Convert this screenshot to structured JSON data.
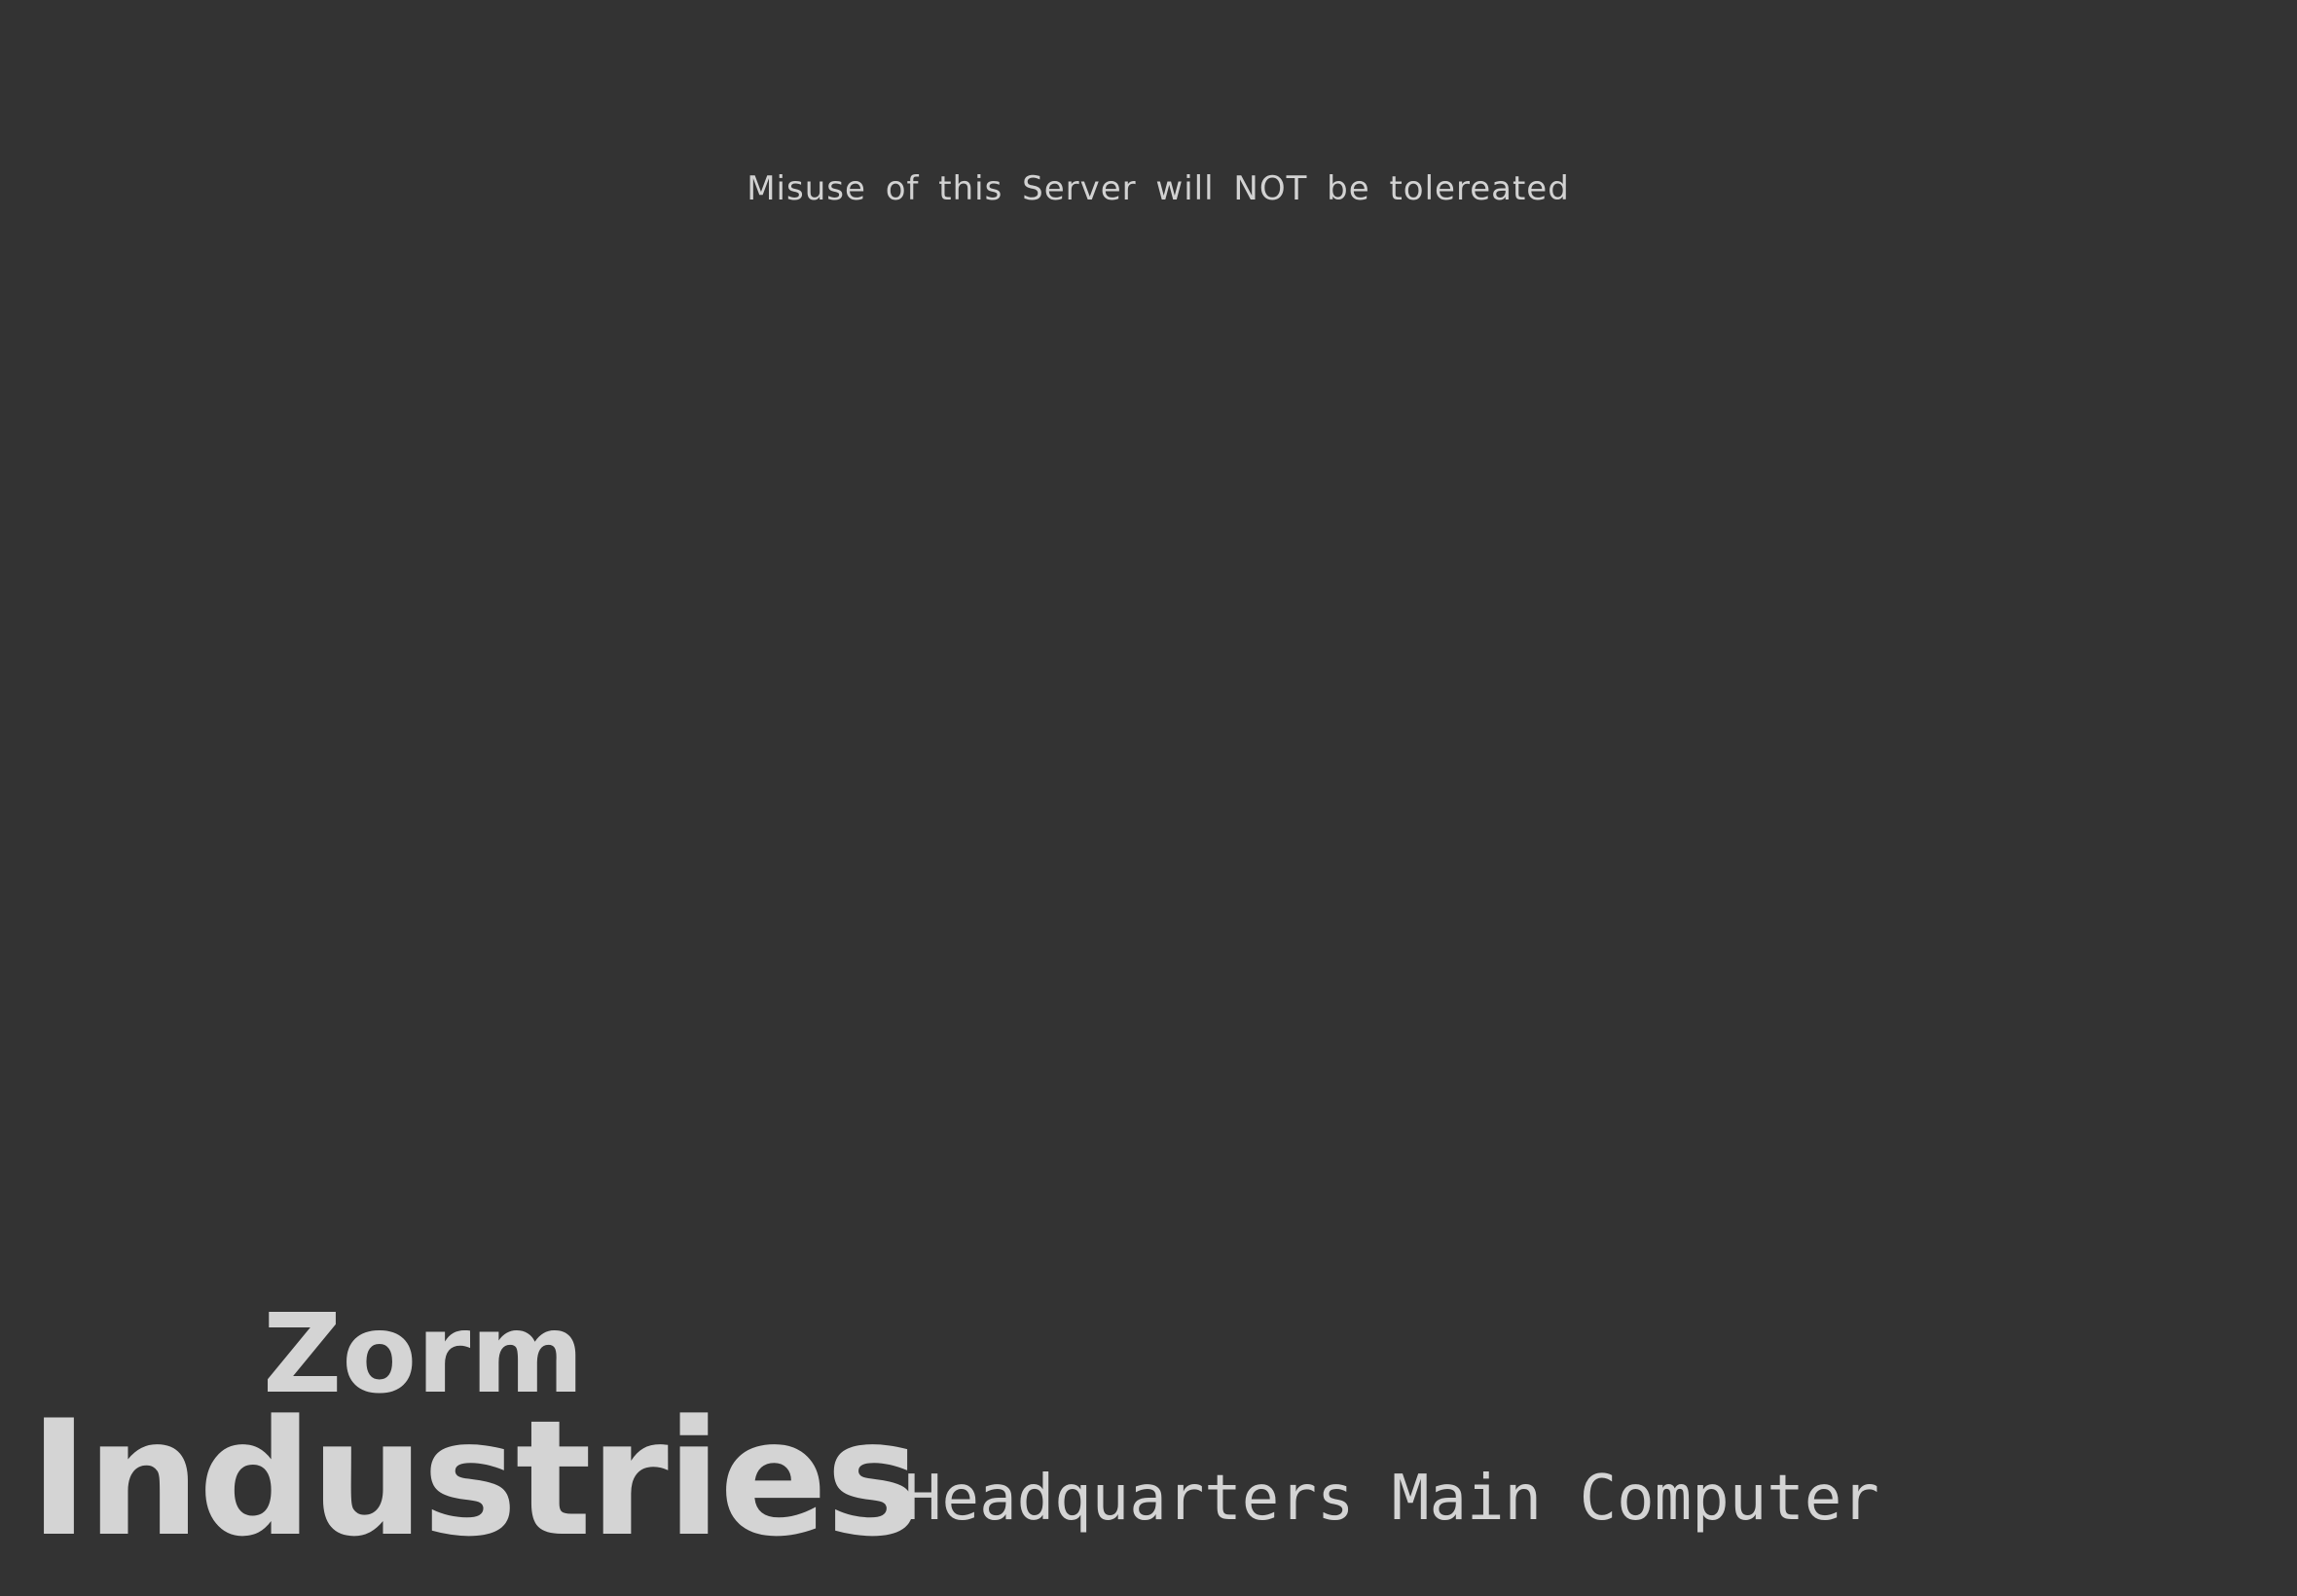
{
  "screen": {
    "background": "#333333",
    "text_color": "#d4d4d4",
    "warning": "Misuse of this Server will NOT be tolereated",
    "logo": {
      "line1": "Zorm",
      "line2": "Industries"
    },
    "subtitle": "Headquarters Main Computer"
  }
}
